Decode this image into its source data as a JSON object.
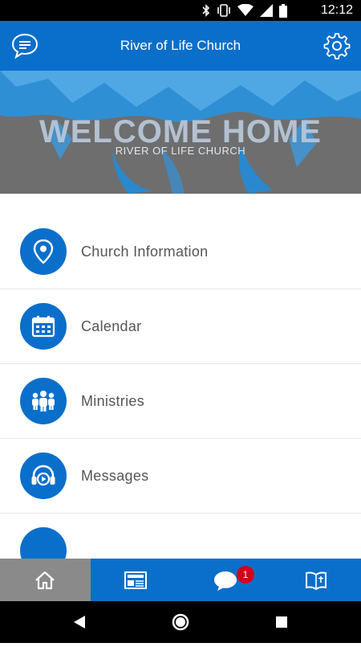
{
  "status_bar": {
    "time": "12:12",
    "icons": [
      "bluetooth-icon",
      "vibrate-icon",
      "wifi-icon",
      "signal-icon",
      "battery-icon"
    ]
  },
  "app_bar": {
    "title": "River of Life Church",
    "left_icon": "chat-icon",
    "right_icon": "gear-icon"
  },
  "banner": {
    "headline": "WELCOME HOME",
    "subline": "RIVER OF LIFE CHURCH"
  },
  "menu": {
    "items": [
      {
        "label": "Church Information",
        "icon": "location-pin-icon"
      },
      {
        "label": "Calendar",
        "icon": "calendar-icon"
      },
      {
        "label": "Ministries",
        "icon": "people-group-icon"
      },
      {
        "label": "Messages",
        "icon": "headphones-play-icon"
      }
    ]
  },
  "tab_bar": {
    "tabs": [
      {
        "name": "home",
        "icon": "home-icon",
        "active": true
      },
      {
        "name": "news",
        "icon": "newspaper-icon",
        "active": false
      },
      {
        "name": "chat",
        "icon": "chat-bubble-icon",
        "active": false,
        "badge": "1"
      },
      {
        "name": "bible",
        "icon": "bible-book-icon",
        "active": false
      }
    ]
  },
  "colors": {
    "primary": "#0a6fcb",
    "active_tab": "#8a8a8a",
    "badge": "#d0021b"
  }
}
